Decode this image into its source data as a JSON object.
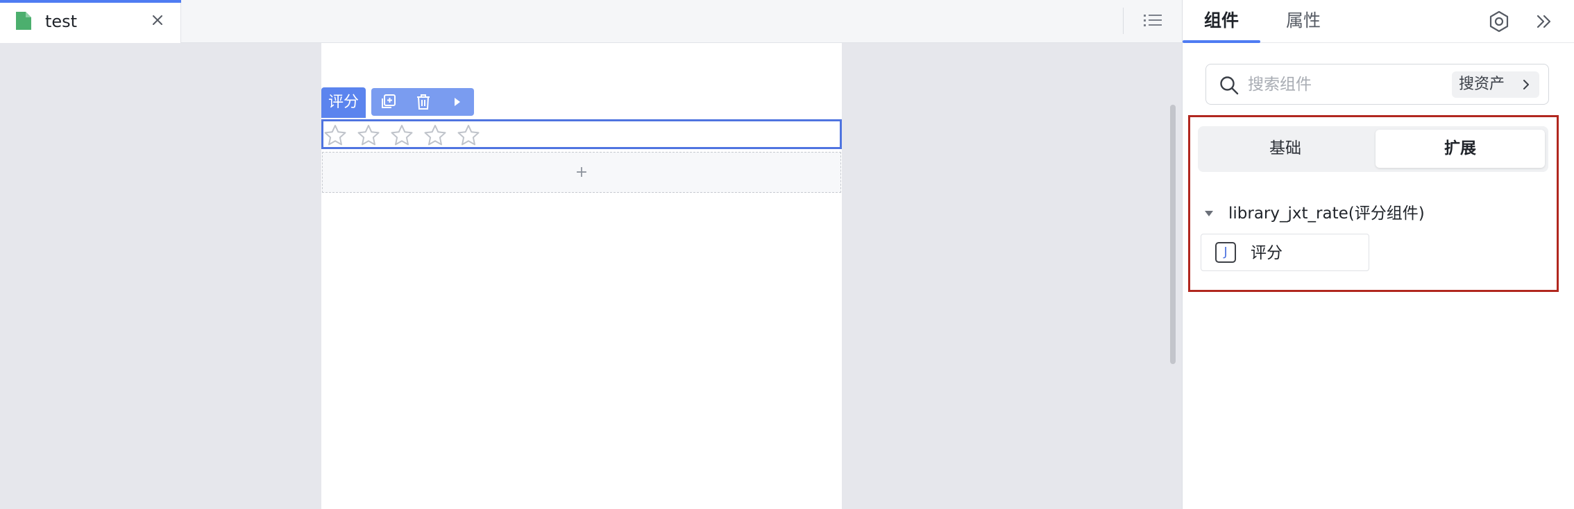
{
  "tabbar": {
    "document_tab": {
      "title": "test",
      "icon": "document-icon",
      "icon_color": "#4caf6e"
    },
    "close_icon": "close-icon",
    "outline_icon": "list-icon"
  },
  "canvas": {
    "component_label": "评分",
    "toolbar_icons": [
      "copy-icon",
      "trash-icon",
      "play-icon"
    ],
    "rate": {
      "max_stars": 5,
      "value": 0
    },
    "add_placeholder": "+"
  },
  "panel": {
    "tabs": [
      {
        "label": "组件",
        "active": true
      },
      {
        "label": "属性",
        "active": false
      }
    ],
    "settings_icon": "hexagon-gear-icon",
    "collapse_icon": "double-chevron-right-icon",
    "search": {
      "placeholder": "搜索组件",
      "value": "",
      "asset_button": "搜资产"
    },
    "segments": [
      {
        "label": "基础",
        "active": false
      },
      {
        "label": "扩展",
        "active": true
      }
    ],
    "groups": [
      {
        "title": "library_jxt_rate(评分组件)",
        "expanded": true,
        "items": [
          {
            "label": "评分",
            "icon_letter": "J"
          }
        ]
      }
    ]
  },
  "colors": {
    "accent": "#4f7cf2",
    "selection": "#4f74e0",
    "highlight_border": "#b1271f",
    "canvas_bg": "#e6e7ec"
  }
}
